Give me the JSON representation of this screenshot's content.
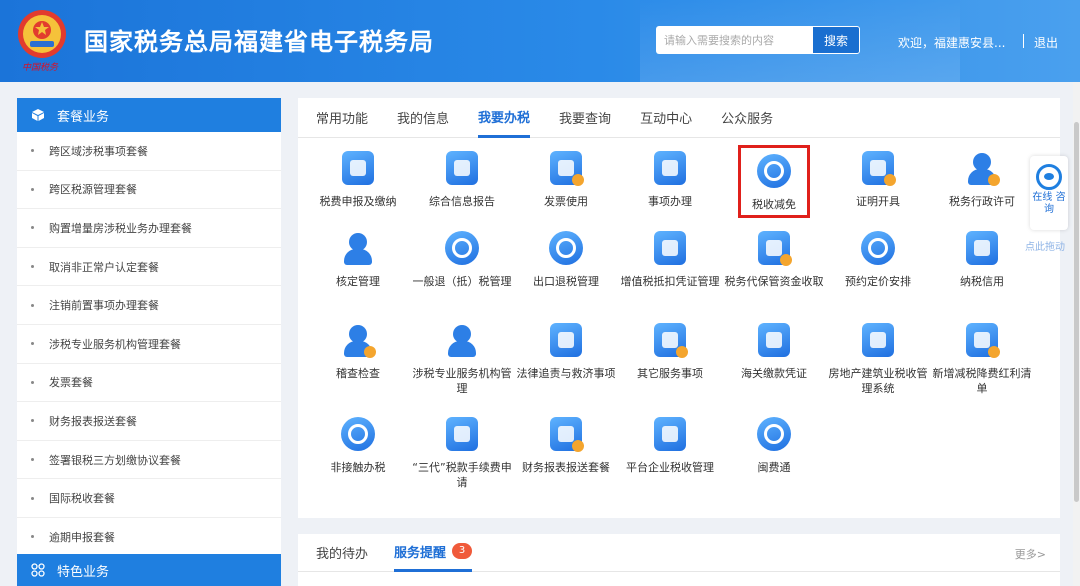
{
  "header": {
    "title": "国家税务总局福建省电子税务局",
    "emblem_caption": "中国税务",
    "search": {
      "placeholder": "请输入需要搜索的内容",
      "button": "搜索"
    },
    "welcome": "欢迎，福建惠安县...",
    "logout": "退出"
  },
  "sidebar": {
    "section1": "套餐业务",
    "items": [
      "跨区域涉税事项套餐",
      "跨区税源管理套餐",
      "购置增量房涉税业务办理套餐",
      "取消非正常户认定套餐",
      "注销前置事项办理套餐",
      "涉税专业服务机构管理套餐",
      "发票套餐",
      "财务报表报送套餐",
      "签署银税三方划缴协议套餐",
      "国际税收套餐",
      "逾期申报套餐"
    ],
    "section2": "特色业务"
  },
  "main": {
    "tabs": [
      "常用功能",
      "我的信息",
      "我要办税",
      "我要查询",
      "互动中心",
      "公众服务"
    ],
    "active_tab": "我要办税",
    "tiles": [
      {
        "label": "税费申报及缴纳",
        "icon": "tax-payment-icon"
      },
      {
        "label": "综合信息报告",
        "icon": "report-doc-icon"
      },
      {
        "label": "发票使用",
        "icon": "invoice-icon"
      },
      {
        "label": "事项办理",
        "icon": "edit-task-icon"
      },
      {
        "label": "税收减免",
        "icon": "tax-relief-icon",
        "highlighted": true
      },
      {
        "label": "证明开具",
        "icon": "certificate-icon"
      },
      {
        "label": "税务行政许可",
        "icon": "admin-license-icon"
      },
      {
        "label": "核定管理",
        "icon": "user-settings-icon"
      },
      {
        "label": "一般退（抵）税管理",
        "icon": "refund-icon"
      },
      {
        "label": "出口退税管理",
        "icon": "export-globe-icon"
      },
      {
        "label": "增值税抵扣凭证管理",
        "icon": "vat-voucher-icon"
      },
      {
        "label": "税务代保管资金收取",
        "icon": "money-bag-icon"
      },
      {
        "label": "预约定价安排",
        "icon": "compass-icon"
      },
      {
        "label": "纳税信用",
        "icon": "credit-diamond-icon"
      },
      {
        "label": "稽查检查",
        "icon": "inspector-icon"
      },
      {
        "label": "涉税专业服务机构管理",
        "icon": "agency-icon"
      },
      {
        "label": "法律追责与救济事项",
        "icon": "gavel-icon"
      },
      {
        "label": "其它服务事项",
        "icon": "clipboard-icon"
      },
      {
        "label": "海关缴款凭证",
        "icon": "customs-check-icon"
      },
      {
        "label": "房地产建筑业税收管理系统",
        "icon": "building-icon"
      },
      {
        "label": "新增减税降费红利清单",
        "icon": "mail-icon"
      },
      {
        "label": "非接触办税",
        "icon": "contactless-globe-icon"
      },
      {
        "label": "“三代”税款手续费申请",
        "icon": "fee-bag-icon"
      },
      {
        "label": "财务报表报送套餐",
        "icon": "finance-stack-icon"
      },
      {
        "label": "平台企业税收管理",
        "icon": "platform-edit-icon"
      },
      {
        "label": "闽费通",
        "icon": "bulb-icon"
      }
    ]
  },
  "float_widget": {
    "label": "在线 咨询",
    "drag_hint": "点此拖动"
  },
  "bottom": {
    "tabs": [
      "我的待办",
      "服务提醒"
    ],
    "active_tab": "服务提醒",
    "badge": "3",
    "more": "更多>"
  },
  "colors": {
    "primary": "#1f7fe0",
    "highlight_border": "#e0201b",
    "badge": "#f05a3a"
  }
}
